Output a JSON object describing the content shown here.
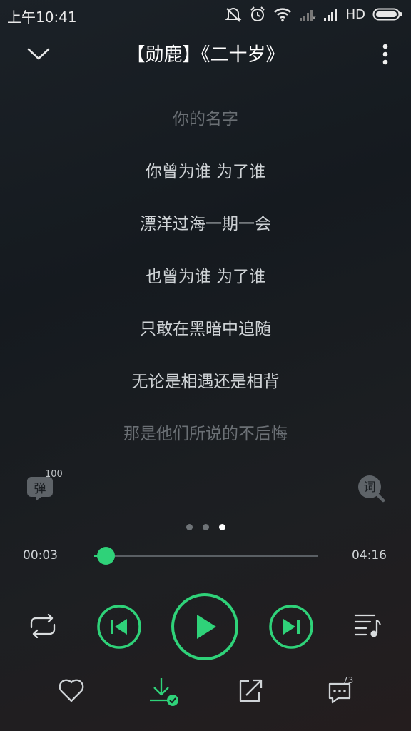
{
  "status_bar": {
    "time": "上午10:41",
    "network": "HD",
    "icons": [
      "mute-icon",
      "alarm-icon",
      "wifi-icon",
      "signal-icon",
      "signal-icon",
      "battery-icon"
    ]
  },
  "header": {
    "title": "【勋鹿】《二十岁》"
  },
  "lyrics": [
    {
      "text": "你的名字",
      "style": "dim"
    },
    {
      "text": "你曾为谁 为了谁",
      "style": "normal"
    },
    {
      "text": "漂洋过海一期一会",
      "style": "normal"
    },
    {
      "text": "也曾为谁 为了谁",
      "style": "normal"
    },
    {
      "text": "只敢在黑暗中追随",
      "style": "normal"
    },
    {
      "text": "无论是相遇还是相背",
      "style": "normal"
    },
    {
      "text": "那是他们所说的不后悔",
      "style": "dim"
    }
  ],
  "side_buttons": {
    "danmu_label": "弹",
    "danmu_count": "100",
    "lyrics_label": "词"
  },
  "pager": {
    "count": 3,
    "active_index": 2
  },
  "player": {
    "current_time": "00:03",
    "total_time": "04:16",
    "progress_fraction": 0.012
  },
  "bottom_bar": {
    "comment_count": "73"
  },
  "colors": {
    "accent": "#2fd279",
    "text": "#cfd3d6",
    "dim_text": "#6b7075"
  }
}
